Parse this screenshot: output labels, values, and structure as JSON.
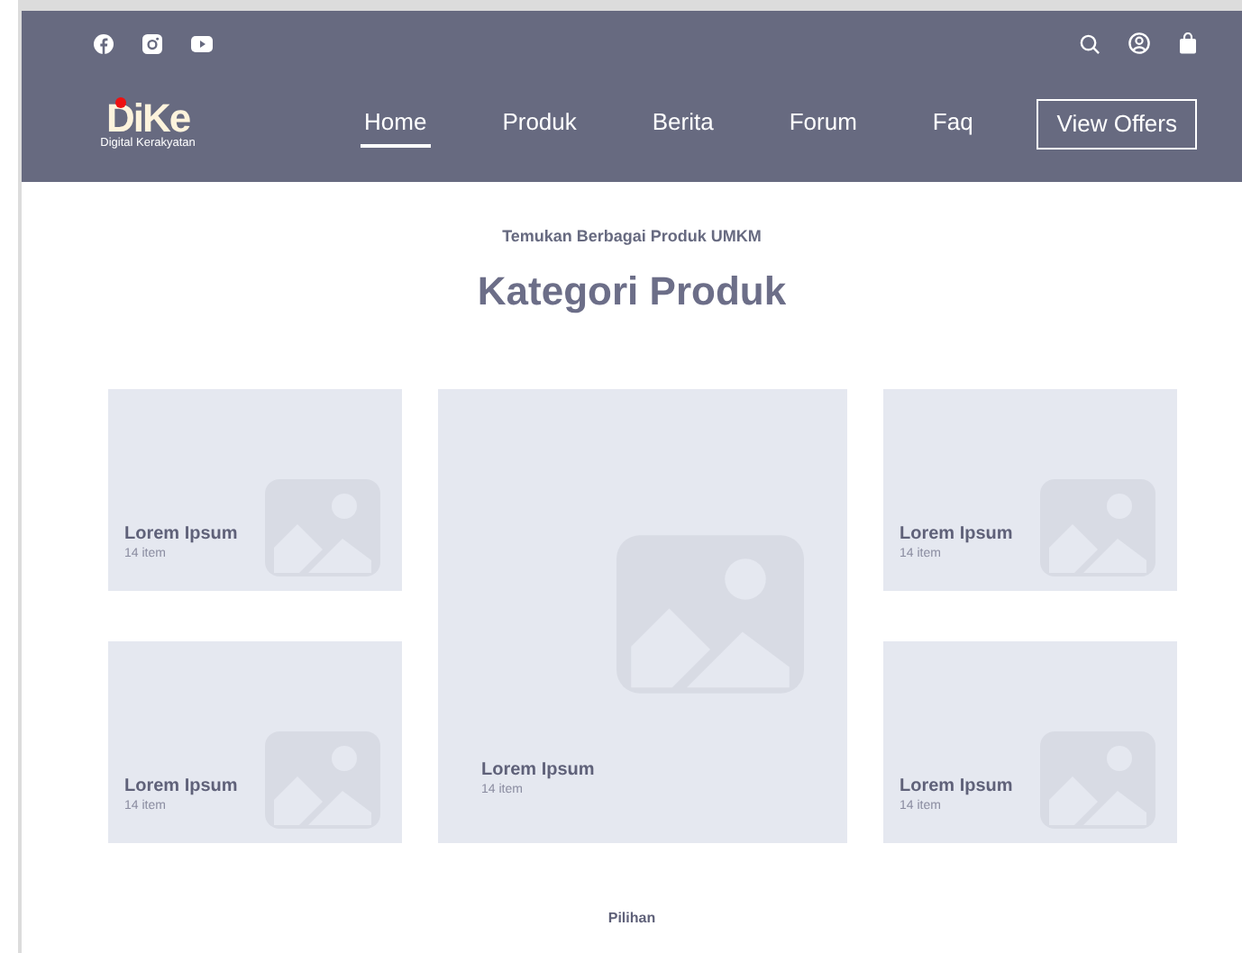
{
  "header": {
    "logo": {
      "name": "DiKe",
      "tagline": "Digital Kerakyatan"
    },
    "nav": [
      {
        "label": "Home",
        "selected": true
      },
      {
        "label": "Produk",
        "selected": false
      },
      {
        "label": "Berita",
        "selected": false
      },
      {
        "label": "Forum",
        "selected": false
      },
      {
        "label": "Faq",
        "selected": false
      }
    ],
    "cta": "View Offers"
  },
  "section": {
    "eyebrow": "Temukan Berbagai Produk UMKM",
    "title": "Kategori Produk",
    "cards": [
      {
        "kind": "small",
        "title": "Lorem Ipsum",
        "count": "14 item"
      },
      {
        "kind": "large",
        "title": "Lorem Ipsum",
        "count": "14 item"
      },
      {
        "kind": "small",
        "title": "Lorem Ipsum",
        "count": "14 item"
      },
      {
        "kind": "small",
        "title": "Lorem Ipsum",
        "count": "14 item"
      },
      {
        "kind": "small",
        "title": "Lorem Ipsum",
        "count": "14 item"
      }
    ]
  },
  "footer_label": "Pilihan"
}
